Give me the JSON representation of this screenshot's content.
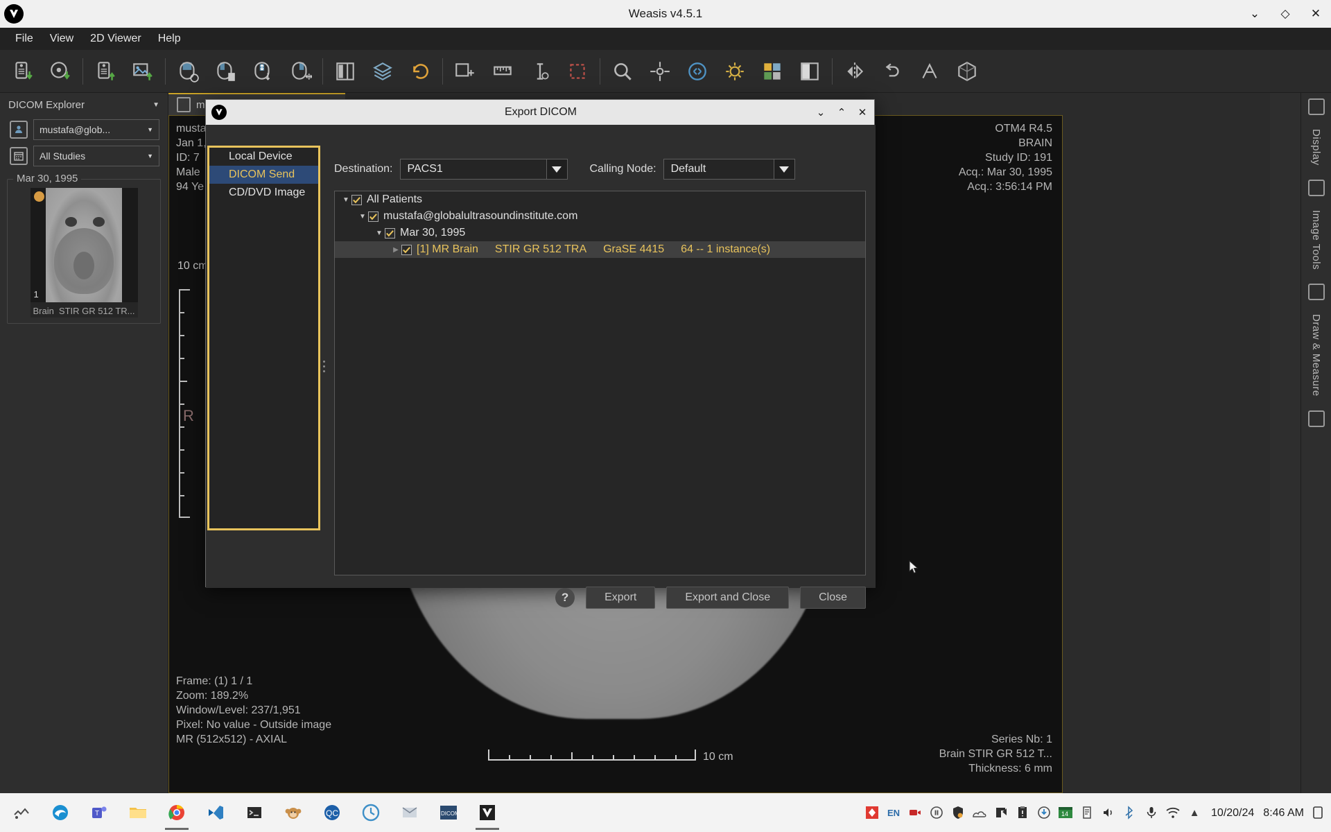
{
  "window": {
    "title": "Weasis v4.5.1",
    "logo_icon": "weasis-logo-icon",
    "controls": [
      {
        "name": "minimize-button",
        "glyph": "⌄"
      },
      {
        "name": "maximize-button",
        "glyph": "◇"
      },
      {
        "name": "close-button",
        "glyph": "✕"
      }
    ]
  },
  "menubar": {
    "items": [
      {
        "name": "menu-file",
        "label": "File"
      },
      {
        "name": "menu-view",
        "label": "View"
      },
      {
        "name": "menu-2d-viewer",
        "label": "2D Viewer"
      },
      {
        "name": "menu-help",
        "label": "Help"
      }
    ]
  },
  "toolbar": {
    "buttons": [
      {
        "name": "import-dicom-icon",
        "title": "Import DICOM"
      },
      {
        "name": "import-cd-icon",
        "title": "Import CD"
      },
      {
        "name": "export-dicom-icon",
        "title": "Export DICOM"
      },
      {
        "name": "export-image-icon",
        "title": "Export image"
      },
      {
        "name": "mouse-left-winlevel-icon",
        "title": "Window/Level"
      },
      {
        "name": "mouse-left-context-icon",
        "title": "Context menu"
      },
      {
        "name": "mouse-wheel-scroll-icon",
        "title": "Scroll series"
      },
      {
        "name": "mouse-right-pan-icon",
        "title": "Pan"
      },
      {
        "name": "layout-icon",
        "title": "Layout"
      },
      {
        "name": "series-stack-icon",
        "title": "Series"
      },
      {
        "name": "reset-icon",
        "title": "Reset"
      },
      {
        "name": "add-measure-icon",
        "title": "Measurement"
      },
      {
        "name": "ruler-icon",
        "title": "Ruler"
      },
      {
        "name": "annotation-icon",
        "title": "Annotations"
      },
      {
        "name": "crop-icon",
        "title": "Crop"
      },
      {
        "name": "zoom-icon",
        "title": "Zoom"
      },
      {
        "name": "pan-target-icon",
        "title": "Pan target"
      },
      {
        "name": "invert-lut-icon",
        "title": "Invert LUT"
      },
      {
        "name": "brightness-icon",
        "title": "Brightness"
      },
      {
        "name": "lut-palette-icon",
        "title": "Pseudo color"
      },
      {
        "name": "contrast-icon",
        "title": "Contrast"
      },
      {
        "name": "flip-icon",
        "title": "Flip"
      },
      {
        "name": "rotate-icon",
        "title": "Rotate"
      },
      {
        "name": "measure-tools-icon",
        "title": "Measure tools"
      },
      {
        "name": "3d-volume-icon",
        "title": "3D"
      }
    ]
  },
  "explorer": {
    "title": "DICOM Explorer",
    "patient_icon": "patient-icon",
    "patient_value": "mustafa@glob...",
    "calendar_icon": "calendar-icon",
    "studies_value": "All Studies",
    "study_date": "Mar 30, 1995",
    "thumbnail": {
      "number": "1",
      "name": "Brain",
      "description": "STIR GR 512  TR..."
    }
  },
  "viewer": {
    "tab_label": "mustafa@globalultrasou...",
    "tab_icon": "patient-tab-icon",
    "tab_close": "✕",
    "overlay_top_left": [
      "musta",
      "Jan 1,",
      "ID: 7",
      "Male",
      "94 Ye"
    ],
    "overlay_bottom_left": [
      "Frame: (1) 1 / 1",
      "Zoom: 189.2%",
      "Window/Level: 237/1,951",
      "Pixel: No value - Outside image",
      "MR (512x512) - AXIAL"
    ],
    "overlay_top_right": [
      "OTM4 R4.5",
      "BRAIN",
      "Study ID: 191",
      "Acq.: Mar 30, 1995",
      "Acq.: 3:56:14 PM"
    ],
    "overlay_bottom_right": [
      "Series Nb: 1",
      "Brain          STIR GR 512  T...",
      "Thickness: 6 mm"
    ],
    "orientation_letter": "R",
    "scale_label_vertical": "10 cm",
    "scale_label_horizontal": "10 cm"
  },
  "right_strip": {
    "icons": [
      {
        "name": "settings-gear-icon"
      },
      {
        "name": "panel-collapse-icon"
      },
      {
        "name": "layers-icon"
      }
    ],
    "sections": [
      {
        "name": "display-section",
        "label": "Display"
      },
      {
        "name": "image-tools-section",
        "label": "Image Tools"
      },
      {
        "name": "draw-measure-section",
        "label": "Draw & Measure"
      }
    ]
  },
  "dialog": {
    "title": "Export DICOM",
    "logo_icon": "weasis-logo-icon",
    "controls": [
      {
        "name": "dialog-minimize-button",
        "glyph": "⌄"
      },
      {
        "name": "dialog-maximize-button",
        "glyph": "⌃"
      },
      {
        "name": "dialog-close-button",
        "glyph": "✕"
      }
    ],
    "sidebar": {
      "items": [
        {
          "name": "sidebar-item-local-device",
          "label": "Local Device",
          "selected": false
        },
        {
          "name": "sidebar-item-dicom-send",
          "label": "DICOM Send",
          "selected": true
        },
        {
          "name": "sidebar-item-cd-dvd-image",
          "label": "CD/DVD Image",
          "selected": false
        }
      ]
    },
    "destination": {
      "label": "Destination:",
      "value": "PACS1"
    },
    "calling_node": {
      "label": "Calling Node:",
      "value": "Default"
    },
    "tree": {
      "rows": [
        {
          "name": "tree-row-all-patients",
          "indent": 0,
          "arrow": "expanded",
          "checked": true,
          "label": "All Patients",
          "highlight": false,
          "selected": false,
          "columns": []
        },
        {
          "name": "tree-row-patient",
          "indent": 1,
          "arrow": "expanded",
          "checked": true,
          "label": "mustafa@globalultrasoundinstitute.com",
          "highlight": false,
          "selected": false,
          "columns": []
        },
        {
          "name": "tree-row-study",
          "indent": 2,
          "arrow": "expanded",
          "checked": true,
          "label": "Mar 30, 1995",
          "highlight": false,
          "selected": false,
          "columns": []
        },
        {
          "name": "tree-row-series",
          "indent": 3,
          "arrow": "collapsed",
          "checked": true,
          "label": "[1] MR Brain",
          "highlight": true,
          "selected": true,
          "columns": [
            "STIR GR 512  TRA",
            "GraSE 4415",
            "64 -- 1 instance(s)"
          ]
        }
      ]
    },
    "buttons": {
      "help": "?",
      "export": "Export",
      "export_and_close": "Export and Close",
      "close": "Close"
    }
  },
  "taskbar": {
    "apps": [
      {
        "name": "taskbar-start-icon"
      },
      {
        "name": "taskbar-edge-icon"
      },
      {
        "name": "taskbar-teams-icon"
      },
      {
        "name": "taskbar-explorer-icon"
      },
      {
        "name": "taskbar-chrome-icon"
      },
      {
        "name": "taskbar-vscode-icon"
      },
      {
        "name": "taskbar-terminal-icon"
      },
      {
        "name": "taskbar-monkey-icon"
      },
      {
        "name": "taskbar-qc-icon"
      },
      {
        "name": "taskbar-clock-app-icon"
      },
      {
        "name": "taskbar-outlook-icon"
      },
      {
        "name": "taskbar-dicom-icon"
      },
      {
        "name": "taskbar-weasis-icon"
      }
    ],
    "tray": [
      {
        "name": "tray-update-icon",
        "glyph": "◈"
      },
      {
        "name": "tray-language-indicator",
        "glyph": "EN"
      },
      {
        "name": "tray-record-icon",
        "glyph": "⏺"
      },
      {
        "name": "tray-pause-icon",
        "glyph": "⊙"
      },
      {
        "name": "tray-security-icon",
        "glyph": "⛨"
      },
      {
        "name": "tray-onedrive-icon",
        "glyph": "☁"
      },
      {
        "name": "tray-share-icon",
        "glyph": "◤"
      },
      {
        "name": "tray-clipboard-icon",
        "glyph": "☰"
      },
      {
        "name": "tray-download-icon",
        "glyph": "ⓘ"
      },
      {
        "name": "tray-calendar-icon",
        "glyph": "Ὄ5"
      },
      {
        "name": "tray-notes-icon",
        "glyph": "☷"
      },
      {
        "name": "tray-volume-icon",
        "glyph": "ὐa"
      },
      {
        "name": "tray-bluetooth-icon",
        "glyph": "฿"
      },
      {
        "name": "tray-microphone-icon",
        "glyph": "Ἲ4"
      },
      {
        "name": "tray-wifi-icon",
        "glyph": "◠"
      },
      {
        "name": "tray-show-hidden-icon",
        "glyph": "▲"
      }
    ],
    "date": "10/20/24",
    "time": "8:46 AM",
    "notification_icon": "notification-center-icon"
  },
  "colors": {
    "accent_yellow": "#e8c35c",
    "selection_blue": "#2d4a77",
    "dialog_bg": "#2e2e2e",
    "app_bg": "#2b2b2b"
  }
}
